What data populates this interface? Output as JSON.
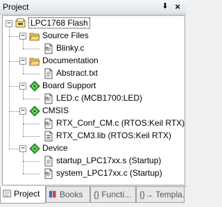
{
  "panel": {
    "title": "Project",
    "pin_glyph": "⬇",
    "close_glyph": "×"
  },
  "tree": {
    "root": {
      "label": "LPC1768 Flash",
      "expanded": true,
      "icon": "target-icon"
    },
    "groups": [
      {
        "label": "Source Files",
        "icon": "folder-open-icon",
        "expanded": true,
        "files": [
          {
            "label": "Blinky.c",
            "icon": "c-file-icon"
          }
        ]
      },
      {
        "label": "Documentation",
        "icon": "folder-open-icon",
        "expanded": true,
        "files": [
          {
            "label": "Abstract.txt",
            "icon": "text-file-icon"
          }
        ]
      },
      {
        "label": "Board Support",
        "icon": "component-diamond-icon",
        "expanded": true,
        "files": [
          {
            "label": "LED.c (MCB1700:LED)",
            "icon": "c-file-icon"
          }
        ]
      },
      {
        "label": "CMSIS",
        "icon": "component-diamond-icon",
        "expanded": true,
        "files": [
          {
            "label": "RTX_Conf_CM.c (RTOS:Keil RTX)",
            "icon": "c-file-icon"
          },
          {
            "label": "RTX_CM3.lib (RTOS:Keil RTX)",
            "icon": "lib-file-icon"
          }
        ]
      },
      {
        "label": "Device",
        "icon": "component-diamond-icon",
        "expanded": true,
        "files": [
          {
            "label": "startup_LPC17xx.s (Startup)",
            "icon": "asm-file-icon"
          },
          {
            "label": "system_LPC17xx.c (Startup)",
            "icon": "c-file-icon"
          }
        ]
      }
    ]
  },
  "tabs": [
    {
      "label": "Project",
      "icon": "project-icon",
      "active": true
    },
    {
      "label": "Books",
      "icon": "books-icon",
      "active": false
    },
    {
      "label": "{} Functi...",
      "icon": "functions-icon",
      "active": false
    },
    {
      "label": "{}→ Templa...",
      "icon": "templates-icon",
      "active": false
    }
  ],
  "colors": {
    "folder": "#e8c35a",
    "diamond": "#2fb52f",
    "border": "#a0a0a0",
    "selection_outline": "#000000"
  }
}
